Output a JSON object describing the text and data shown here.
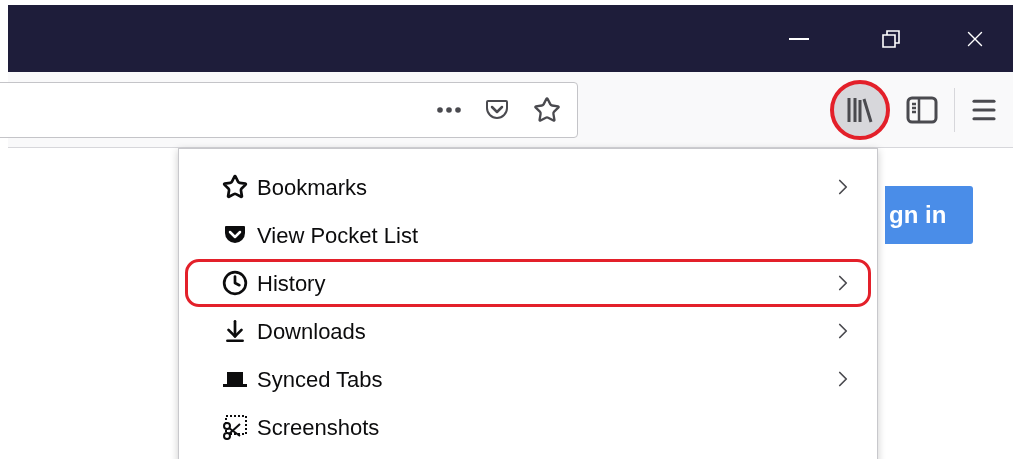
{
  "toolbar": {
    "library_button": {
      "annotated": true
    }
  },
  "menu": {
    "items": [
      {
        "kind": "bookmarks",
        "label": "Bookmarks",
        "submenu": true,
        "annotated": false
      },
      {
        "kind": "pocket",
        "label": "View Pocket List",
        "submenu": false,
        "annotated": false
      },
      {
        "kind": "history",
        "label": "History",
        "submenu": true,
        "annotated": true
      },
      {
        "kind": "downloads",
        "label": "Downloads",
        "submenu": true,
        "annotated": false
      },
      {
        "kind": "synced",
        "label": "Synced Tabs",
        "submenu": true,
        "annotated": false
      },
      {
        "kind": "screenshots",
        "label": "Screenshots",
        "submenu": false,
        "annotated": false
      }
    ]
  },
  "page": {
    "sign_in_button": "gn in"
  }
}
